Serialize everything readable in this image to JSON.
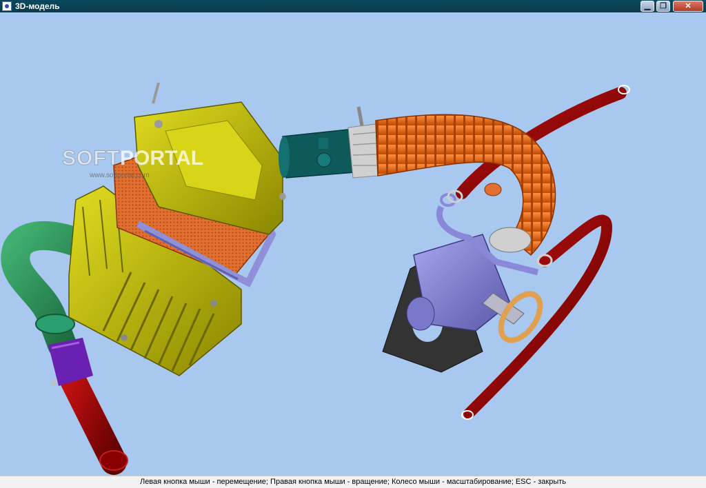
{
  "window": {
    "title": "3D-модель",
    "buttons": {
      "minimize": "▁",
      "maximize": "❐",
      "close": "✕"
    }
  },
  "watermark": {
    "soft": "SOFT",
    "portal": "PORTAL",
    "sub": "www.softportal.com"
  },
  "statusbar": {
    "text": "Левая кнопка мыши - перемещение; Правая кнопка мыши - вращение; Колесо мыши - масштабирование; ESC - закрыть"
  },
  "colors": {
    "background": "#a8c8f0",
    "airbox": "#c8c400",
    "filter": "#e07030",
    "filter_frame": "#9090d8",
    "sensor": "#0e5a5a",
    "intake_hose": "#f07020",
    "red_hose": "#a00000",
    "green_pipe": "#2a8a5a",
    "purple_clamp": "#6a20b0",
    "throttle_body": "#8a88d8",
    "gasket": "#333333",
    "ring": "#e0a050"
  }
}
